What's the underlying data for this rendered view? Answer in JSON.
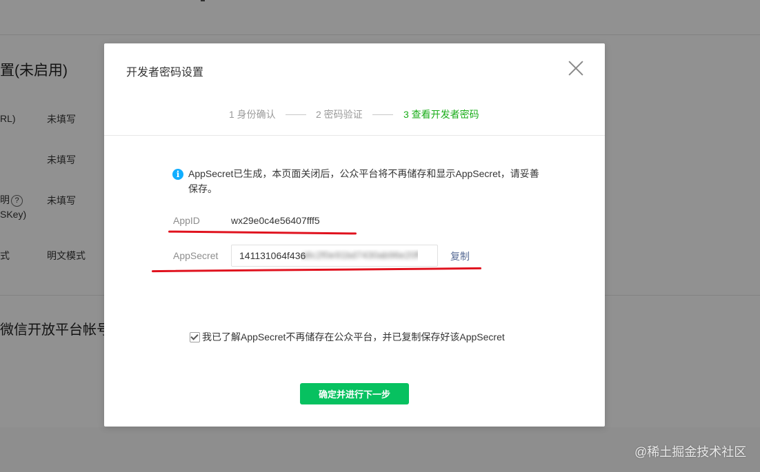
{
  "background": {
    "section_title": "置(未启用)",
    "rows": [
      {
        "label": "RL)",
        "value": "未填写"
      },
      {
        "label": "",
        "value": "未填写"
      },
      {
        "label_line1": "明",
        "label_line2": "SKey)",
        "value": "未填写"
      },
      {
        "label": "式",
        "value": "明文模式"
      }
    ],
    "section_title2": "微信开放平台帐号"
  },
  "dialog": {
    "title": "开发者密码设置",
    "steps": [
      {
        "label": "1 身份确认",
        "active": false
      },
      {
        "label": "2 密码验证",
        "active": false
      },
      {
        "label": "3 查看开发者密码",
        "active": true
      }
    ],
    "notice": "AppSecret已生成，本页面关闭后，公众平台将不再储存和显示AppSecret，请妥善保存。",
    "appid_label": "AppID",
    "appid_value": "wx29e0c4e56407fff5",
    "appsecret_label": "AppSecret",
    "appsecret_value_visible": "141131064f436",
    "copy_label": "复制",
    "checkbox_checked": true,
    "checkbox_label": "我已了解AppSecret不再储存在公众平台，并已复制保存好该AppSecret",
    "confirm_button": "确定并进行下一步"
  },
  "watermark": "@稀土掘金技术社区",
  "colors": {
    "accent_green": "#07c160",
    "active_step": "#1aad19",
    "link": "#576b95",
    "info_icon": "#10aeff",
    "annotation_red": "#e0121e"
  }
}
